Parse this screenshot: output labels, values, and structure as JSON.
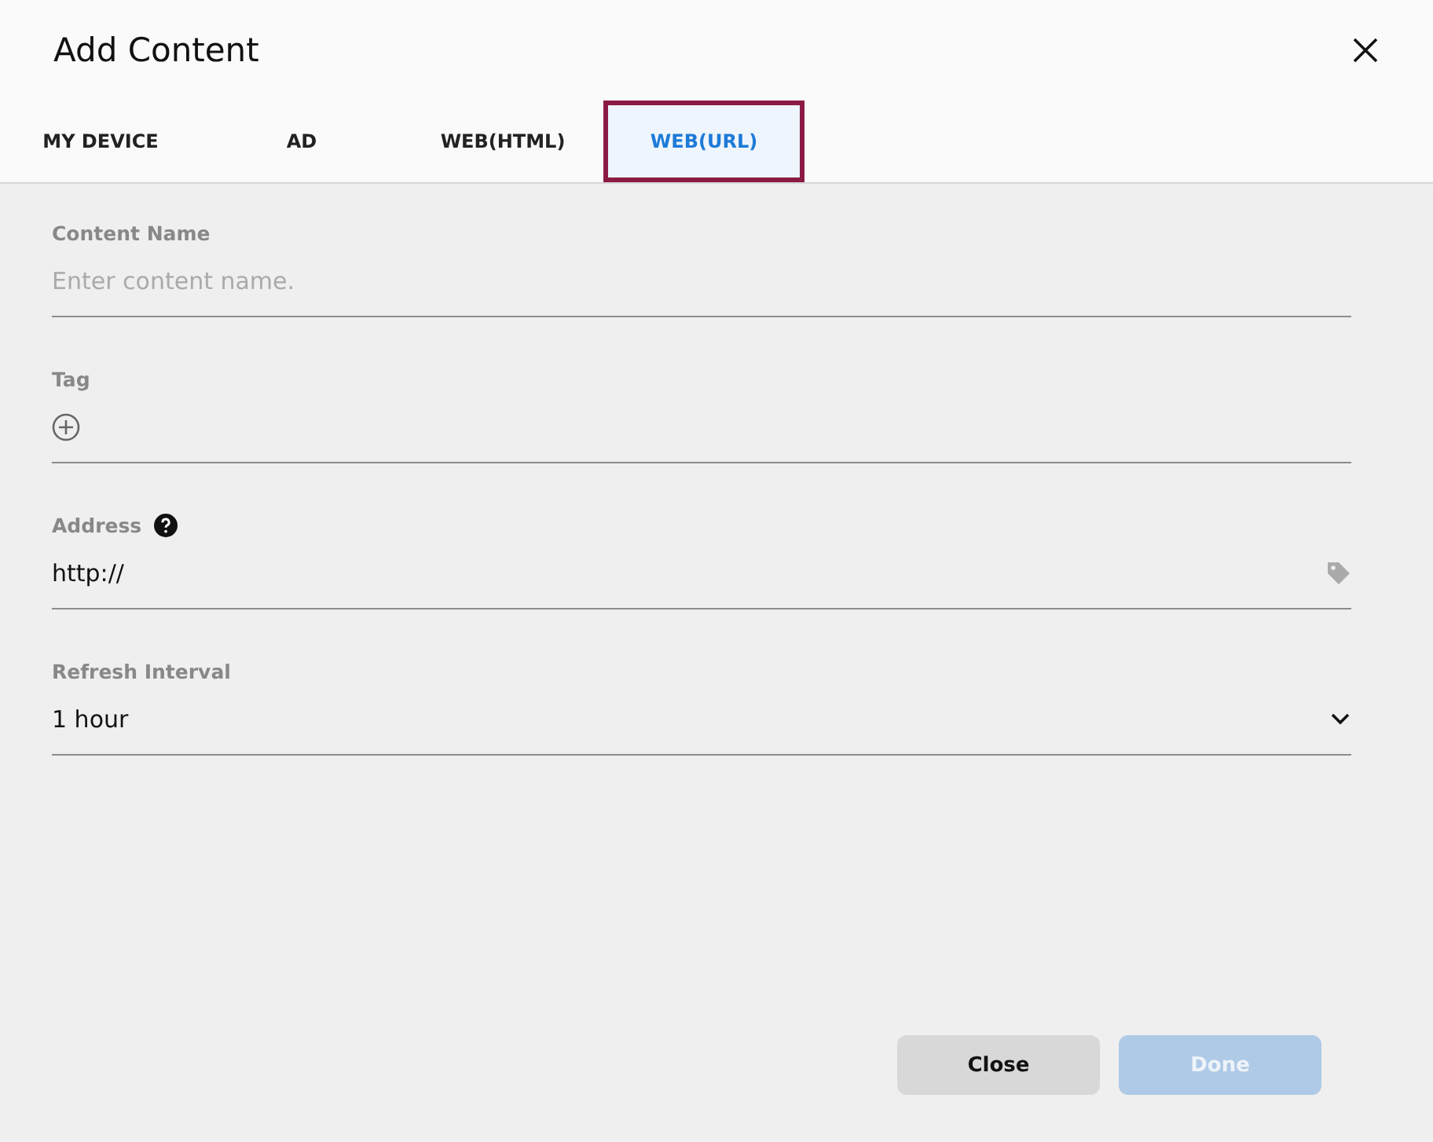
{
  "dialog": {
    "title": "Add Content"
  },
  "tabs": [
    {
      "label": "MY DEVICE",
      "selected": false
    },
    {
      "label": "AD",
      "selected": false
    },
    {
      "label": "WEB(HTML)",
      "selected": false
    },
    {
      "label": "WEB(URL)",
      "selected": true
    }
  ],
  "fields": [
    {
      "kind": "text",
      "label": "Content Name",
      "placeholder": "Enter content name."
    },
    {
      "kind": "tag",
      "label": "Tag"
    },
    {
      "kind": "url",
      "label": "Address",
      "help": true,
      "value": "http://"
    },
    {
      "kind": "select",
      "label": "Refresh Interval",
      "value": "1 hour"
    }
  ],
  "buttons": [
    {
      "label": "Close",
      "disabled": false
    },
    {
      "label": "Done",
      "disabled": true
    }
  ]
}
